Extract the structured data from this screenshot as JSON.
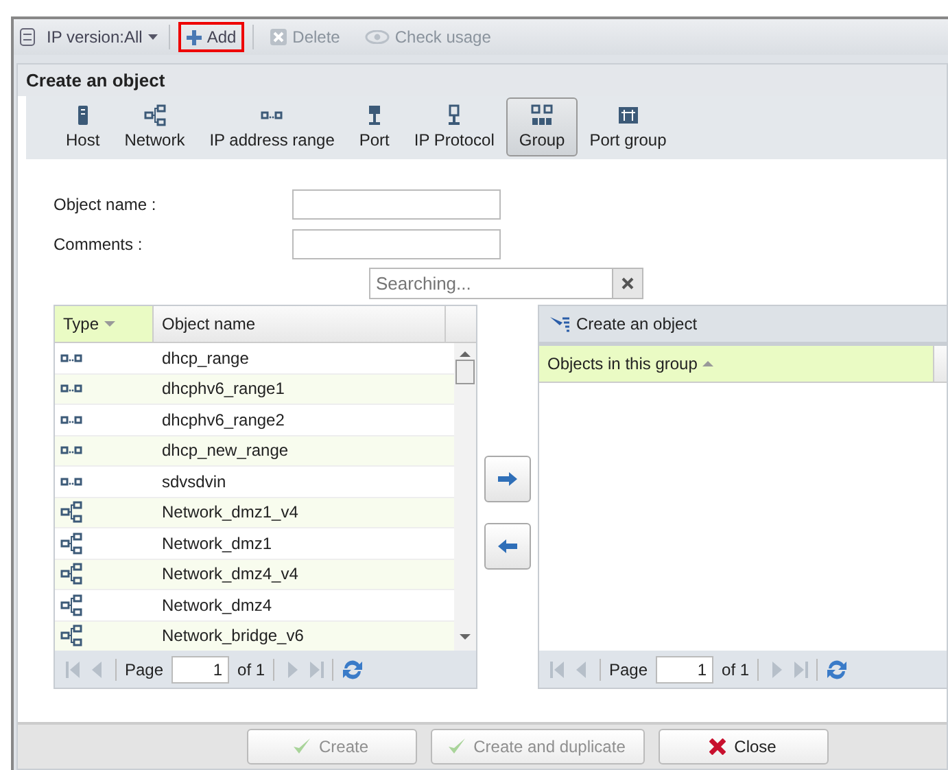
{
  "toolbar": {
    "ip_version": "IP version:All",
    "buttons": [
      {
        "kind": "add",
        "label": "Add",
        "disabled": false,
        "highlighted": true
      },
      {
        "kind": "delete",
        "label": "Delete",
        "disabled": true,
        "highlighted": false
      },
      {
        "kind": "usage",
        "label": "Check usage",
        "disabled": true,
        "highlighted": false
      }
    ]
  },
  "dialog": {
    "title": "Create an object",
    "types": [
      {
        "kind": "host",
        "label": "Host",
        "selected": false
      },
      {
        "kind": "network",
        "label": "Network",
        "selected": false
      },
      {
        "kind": "range",
        "label": "IP address range",
        "selected": false
      },
      {
        "kind": "port",
        "label": "Port",
        "selected": false
      },
      {
        "kind": "protocol",
        "label": "IP Protocol",
        "selected": false
      },
      {
        "kind": "group",
        "label": "Group",
        "selected": true
      },
      {
        "kind": "portgroup",
        "label": "Port group",
        "selected": false
      }
    ],
    "fields": [
      {
        "label": "Object name :"
      },
      {
        "label": "Comments :"
      }
    ],
    "search": {
      "placeholder": "Searching..."
    },
    "available": {
      "columns": [
        {
          "label": "Type",
          "sorted": true,
          "ascending": false
        },
        {
          "label": "Object name"
        }
      ],
      "rows": [
        {
          "kind": "range",
          "name": "dhcp_range"
        },
        {
          "kind": "range",
          "name": "dhcphv6_range1"
        },
        {
          "kind": "range",
          "name": "dhcphv6_range2"
        },
        {
          "kind": "range",
          "name": "dhcp_new_range"
        },
        {
          "kind": "range",
          "name": "sdvsdvin"
        },
        {
          "kind": "network",
          "name": "Network_dmz1_v4"
        },
        {
          "kind": "network",
          "name": "Network_dmz1"
        },
        {
          "kind": "network",
          "name": "Network_dmz4_v4"
        },
        {
          "kind": "network",
          "name": "Network_dmz4"
        },
        {
          "kind": "network",
          "name": "Network_bridge_v6"
        }
      ],
      "pager": {
        "label": "Page",
        "page": "1",
        "total": "of 1"
      }
    },
    "members": {
      "create_label": "Create an object",
      "columns": [
        {
          "label": "Objects in this group",
          "sorted": true,
          "ascending": true
        }
      ],
      "pager": {
        "label": "Page",
        "page": "1",
        "total": "of 1"
      }
    },
    "buttons": [
      {
        "kind": "create",
        "label": "Create",
        "disabled": true
      },
      {
        "kind": "duplicate",
        "label": "Create and duplicate",
        "disabled": true
      },
      {
        "kind": "close",
        "label": "Close",
        "disabled": false
      }
    ]
  }
}
